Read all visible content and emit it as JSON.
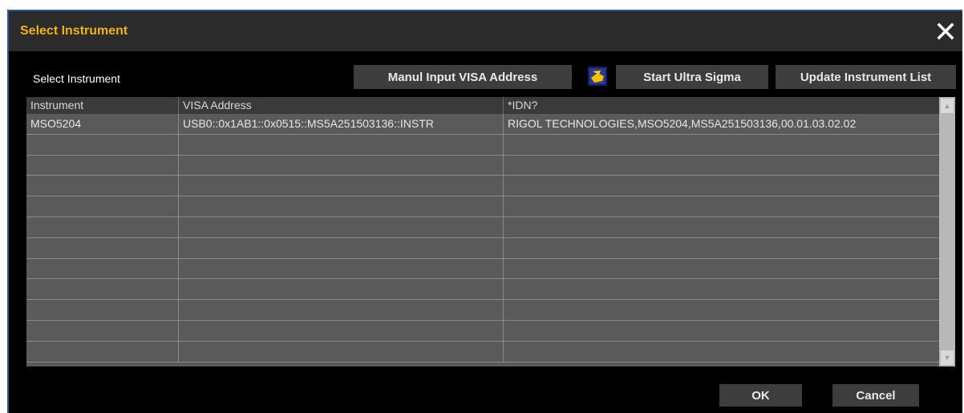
{
  "dialog": {
    "title": "Select Instrument",
    "close_icon": "close-icon",
    "section_label": "Select Instrument"
  },
  "toolbar": {
    "manual_label": "Manul Input VISA  Address",
    "ultra_sigma_label": "Start Ultra Sigma",
    "ultra_sigma_icon": "ultra-sigma-icon",
    "update_label": "Update Instrument List"
  },
  "table": {
    "columns": [
      "Instrument",
      "VISA Address",
      "*IDN?"
    ],
    "rows": [
      [
        "MSO5204",
        "USB0::0x1AB1::0x0515::MS5A251503136::INSTR",
        "RIGOL TECHNOLOGIES,MSO5204,MS5A251503136,00.01.03.02.02"
      ],
      [
        "",
        "",
        ""
      ],
      [
        "",
        "",
        ""
      ],
      [
        "",
        "",
        ""
      ],
      [
        "",
        "",
        ""
      ],
      [
        "",
        "",
        ""
      ],
      [
        "",
        "",
        ""
      ],
      [
        "",
        "",
        ""
      ],
      [
        "",
        "",
        ""
      ],
      [
        "",
        "",
        ""
      ],
      [
        "",
        "",
        ""
      ],
      [
        "",
        "",
        ""
      ]
    ]
  },
  "footer": {
    "ok_label": "OK",
    "cancel_label": "Cancel"
  },
  "colors": {
    "title": "#f0b21c",
    "background": "#000000",
    "button": "#3d3d3d",
    "table_row": "#5a5a5a"
  }
}
